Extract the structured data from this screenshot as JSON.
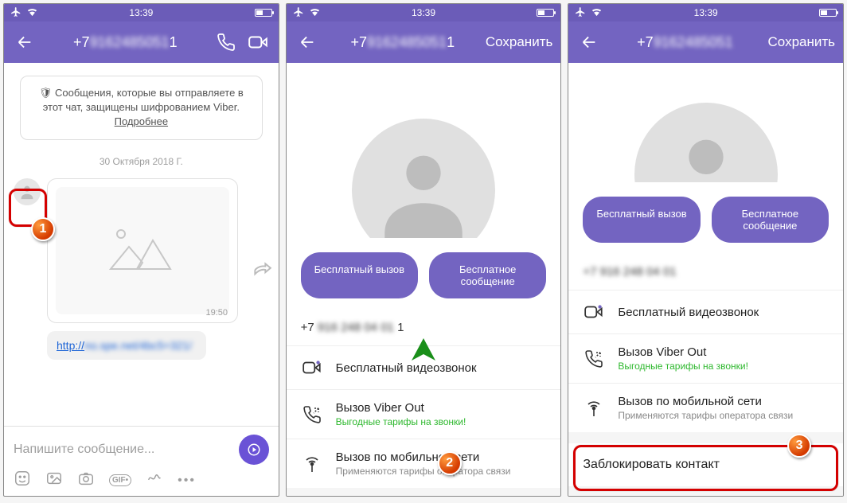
{
  "status": {
    "time": "13:39"
  },
  "badges": {
    "one": "1",
    "two": "2",
    "three": "3"
  },
  "screen1": {
    "title_prefix": "+7",
    "title_hidden": "9162485051",
    "title_suffix": "1",
    "encryption": "Сообщения, которые вы отправляете в этот чат, защищены шифрованием Viber.",
    "encryption_more": "Подробнее",
    "date": "30 Октября 2018 Г.",
    "msg_time": "19:50",
    "link_prefix": "http://",
    "link_hidden": "no.spe.net/4bc5=321/",
    "composer_placeholder": "Напишите сообщение..."
  },
  "screen2": {
    "title_prefix": "+7",
    "title_hidden": "9162485051",
    "title_suffix": "1",
    "save": "Сохранить",
    "btn_call": "Бесплатный вызов",
    "btn_msg": "Бесплатное сообщение",
    "phone_prefix": "+7",
    "phone_hidden": "916 248 04 01",
    "phone_suffix": "1",
    "opt_video": "Бесплатный видеозвонок",
    "opt_viberout": "Вызов Viber Out",
    "opt_viberout_sub": "Выгодные тарифы на звонки!",
    "opt_mobile": "Вызов по мобильной сети",
    "opt_mobile_sub": "Применяются тарифы оператора связи"
  },
  "screen3": {
    "title_prefix": "+7",
    "title_hidden": "9162485051",
    "save": "Сохранить",
    "btn_call": "Бесплатный вызов",
    "btn_msg": "Бесплатное сообщение",
    "phone_hidden": "+7 916 248 04 01",
    "opt_video": "Бесплатный видеозвонок",
    "opt_viberout": "Вызов Viber Out",
    "opt_viberout_sub": "Выгодные тарифы на звонки!",
    "opt_mobile": "Вызов по мобильной сети",
    "opt_mobile_sub": "Применяются тарифы оператора связи",
    "block": "Заблокировать контакт"
  }
}
